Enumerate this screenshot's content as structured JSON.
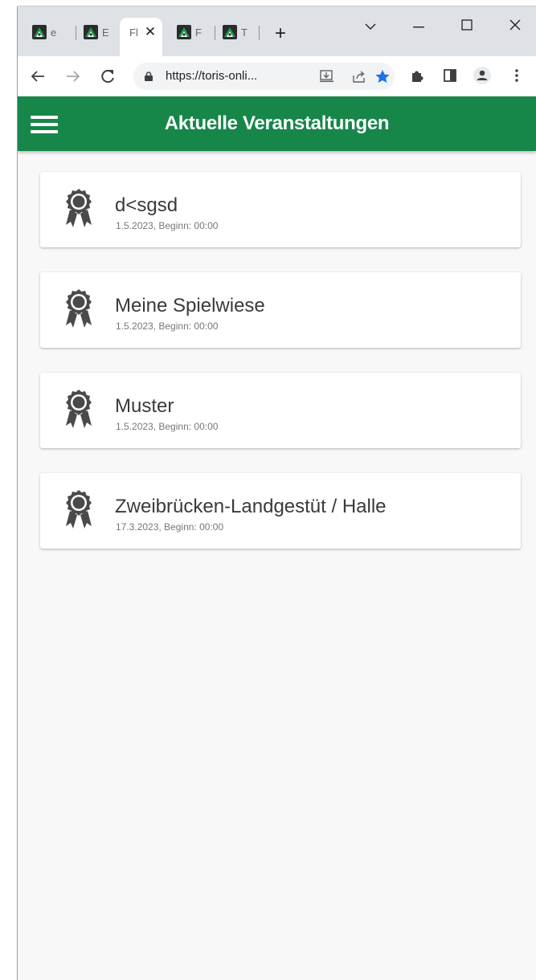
{
  "browser": {
    "tabs": [
      {
        "label": "e",
        "active": false
      },
      {
        "label": "E",
        "active": false
      },
      {
        "label": "Fl",
        "active": true
      },
      {
        "label": "F",
        "active": false
      },
      {
        "label": "T",
        "active": false
      }
    ],
    "url": "https://toris-onli...",
    "accent": "#1a73e8"
  },
  "app": {
    "title": "Aktuelle Veranstaltungen",
    "brand_color": "#168649"
  },
  "events": [
    {
      "name": "d<sgsd",
      "date": "1.5.2023, Beginn: 00:00",
      "icon": "award-icon"
    },
    {
      "name": "Meine Spielwiese",
      "date": "1.5.2023, Beginn: 00:00",
      "icon": "award-icon"
    },
    {
      "name": "Muster",
      "date": "1.5.2023, Beginn: 00:00",
      "icon": "award-icon"
    },
    {
      "name": "Zweibrücken-Landgestüt / Halle",
      "date": "17.3.2023, Beginn: 00:00",
      "icon": "award-icon"
    }
  ]
}
